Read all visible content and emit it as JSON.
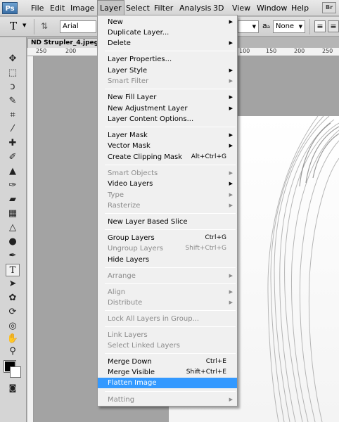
{
  "app_logo": "Ps",
  "menubar": {
    "items": [
      "File",
      "Edit",
      "Image",
      "Layer",
      "Select",
      "Filter",
      "Analysis",
      "3D",
      "View",
      "Window",
      "Help"
    ],
    "bridge_button": "Br"
  },
  "optionsbar": {
    "tool_glyph": "T",
    "font_family": "Arial",
    "aa_glyph": "aₐ",
    "antialias": "None"
  },
  "document": {
    "tab_title": "ND Strupler_4.jpeg @",
    "ruler_labels": [
      "250",
      "200",
      "100",
      "150",
      "200",
      "250"
    ]
  },
  "layer_menu": {
    "items": [
      {
        "label": "New",
        "submenu": true,
        "enabled": true
      },
      {
        "label": "Duplicate Layer...",
        "enabled": true
      },
      {
        "label": "Delete",
        "submenu": true,
        "enabled": true
      },
      {
        "label": "Layer Properties...",
        "enabled": true
      },
      {
        "label": "Layer Style",
        "submenu": true,
        "enabled": true
      },
      {
        "label": "Smart Filter",
        "submenu": true,
        "enabled": false
      },
      {
        "label": "New Fill Layer",
        "submenu": true,
        "enabled": true
      },
      {
        "label": "New Adjustment Layer",
        "submenu": true,
        "enabled": true
      },
      {
        "label": "Layer Content Options...",
        "enabled": true
      },
      {
        "label": "Layer Mask",
        "submenu": true,
        "enabled": true
      },
      {
        "label": "Vector Mask",
        "submenu": true,
        "enabled": true
      },
      {
        "label": "Create Clipping Mask",
        "shortcut": "Alt+Ctrl+G",
        "enabled": true
      },
      {
        "label": "Smart Objects",
        "submenu": true,
        "enabled": false
      },
      {
        "label": "Video Layers",
        "submenu": true,
        "enabled": true
      },
      {
        "label": "Type",
        "submenu": true,
        "enabled": false
      },
      {
        "label": "Rasterize",
        "submenu": true,
        "enabled": false
      },
      {
        "label": "New Layer Based Slice",
        "enabled": true
      },
      {
        "label": "Group Layers",
        "shortcut": "Ctrl+G",
        "enabled": true
      },
      {
        "label": "Ungroup Layers",
        "shortcut": "Shift+Ctrl+G",
        "enabled": false
      },
      {
        "label": "Hide Layers",
        "enabled": true
      },
      {
        "label": "Arrange",
        "submenu": true,
        "enabled": false
      },
      {
        "label": "Align",
        "submenu": true,
        "enabled": false
      },
      {
        "label": "Distribute",
        "submenu": true,
        "enabled": false
      },
      {
        "label": "Lock All Layers in Group...",
        "enabled": false
      },
      {
        "label": "Link Layers",
        "enabled": false
      },
      {
        "label": "Select Linked Layers",
        "enabled": false
      },
      {
        "label": "Merge Down",
        "shortcut": "Ctrl+E",
        "enabled": true
      },
      {
        "label": "Merge Visible",
        "shortcut": "Shift+Ctrl+E",
        "enabled": true
      },
      {
        "label": "Flatten Image",
        "enabled": true,
        "highlighted": true
      },
      {
        "label": "Matting",
        "submenu": true,
        "enabled": false
      }
    ]
  },
  "tools": [
    "move",
    "marquee",
    "lasso",
    "quick-select",
    "crop",
    "eyedropper",
    "healing",
    "brush",
    "stamp",
    "history-brush",
    "eraser",
    "gradient",
    "blur",
    "dodge",
    "pen",
    "type",
    "path-select",
    "shape",
    "3d-rotate",
    "3d-orbit",
    "hand",
    "zoom"
  ],
  "colors": {
    "foreground": "#000000",
    "background": "#ffffff",
    "highlight": "#3399ff"
  }
}
